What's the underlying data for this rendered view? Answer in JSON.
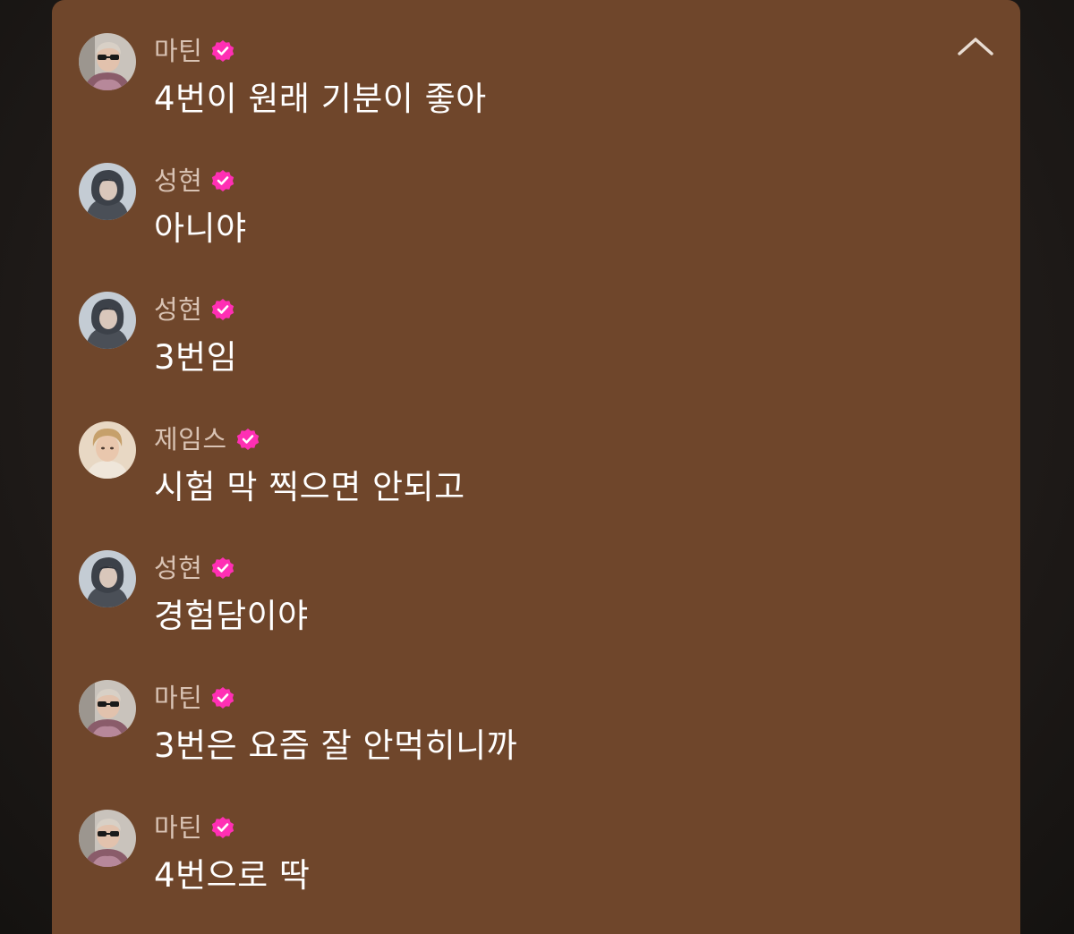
{
  "chat": {
    "accent_color": "#ff2fb4",
    "panel_color": "#6f462b",
    "collapse_icon": "chevron-up-icon",
    "messages": [
      {
        "sender": "마틴",
        "avatar": "martin",
        "text": "4번이 원래 기분이 좋아"
      },
      {
        "sender": "성현",
        "avatar": "sunghyun",
        "text": "아니야"
      },
      {
        "sender": "성현",
        "avatar": "sunghyun",
        "text": "3번임"
      },
      {
        "sender": "제임스",
        "avatar": "james",
        "text": "시험 막 찍으면 안되고"
      },
      {
        "sender": "성현",
        "avatar": "sunghyun",
        "text": "경험담이야"
      },
      {
        "sender": "마틴",
        "avatar": "martin",
        "text": "3번은 요즘 잘 안먹히니까"
      },
      {
        "sender": "마틴",
        "avatar": "martin",
        "text": "4번으로 딱"
      }
    ]
  }
}
